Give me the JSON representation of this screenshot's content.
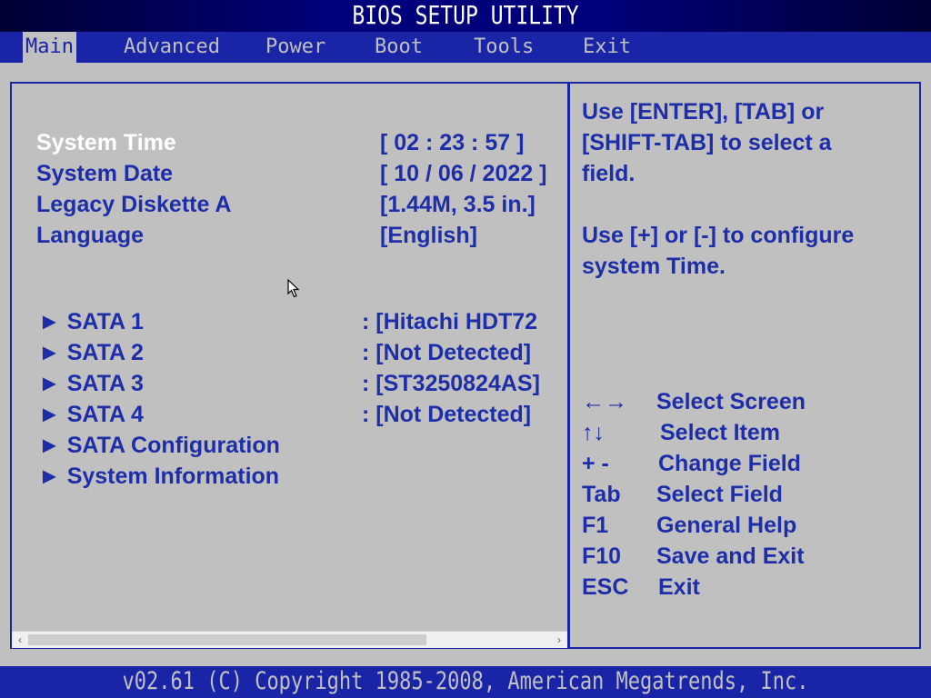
{
  "window": {
    "title": "BIOS SETUP UTILITY"
  },
  "menu": [
    "Main",
    "Advanced",
    "Power",
    "Boot",
    "Tools",
    "Exit"
  ],
  "settings": [
    {
      "label": "System Time",
      "value": "[ 02 : 23  : 57  ]"
    },
    {
      "label": "System Date",
      "value": "[ 10 / 06 / 2022 ]"
    },
    {
      "label": "Legacy Diskette A",
      "value": "[1.44M, 3.5 in.]"
    },
    {
      "label": "Language",
      "value": "[English]"
    }
  ],
  "devices": [
    {
      "label": "► SATA 1",
      "value": ": [Hitachi HDT72"
    },
    {
      "label": "► SATA 2",
      "value": ": [Not Detected]"
    },
    {
      "label": "► SATA 3",
      "value": ": [ST3250824AS]"
    },
    {
      "label": "► SATA 4",
      "value": ": [Not Detected]"
    },
    {
      "label": "► SATA Configuration",
      "value": ""
    },
    {
      "label": "► System Information",
      "value": ""
    }
  ],
  "help_text": [
    "Use [ENTER], [TAB] or",
    "[SHIFT-TAB] to select a",
    "field.",
    "Use [+] or [-] to configure",
    "system Time."
  ],
  "keys": [
    {
      "key": "←→",
      "desc": "Select Screen"
    },
    {
      "key": "↑↓",
      "desc": "Select Item"
    },
    {
      "key": "+ -",
      "desc": "Change Field"
    },
    {
      "key": "Tab",
      "desc": "Select Field"
    },
    {
      "key": "F1",
      "desc": "General Help"
    },
    {
      "key": "F10",
      "desc": "Save and Exit"
    },
    {
      "key": "ESC",
      "desc": "Exit"
    }
  ],
  "footer": {
    "text": "v02.61 (C) Copyright 1985-2008, American Megatrends, Inc."
  },
  "colors": {
    "background": "#c0c0c0",
    "accent": "#1a24a6",
    "text": "#1e2ea8",
    "selected": "#ffffff"
  },
  "icons": {
    "cursor": "mouse-pointer-icon",
    "scroll_left": "scroll-left-arrow-icon",
    "scroll_right": "scroll-right-arrow-icon"
  }
}
